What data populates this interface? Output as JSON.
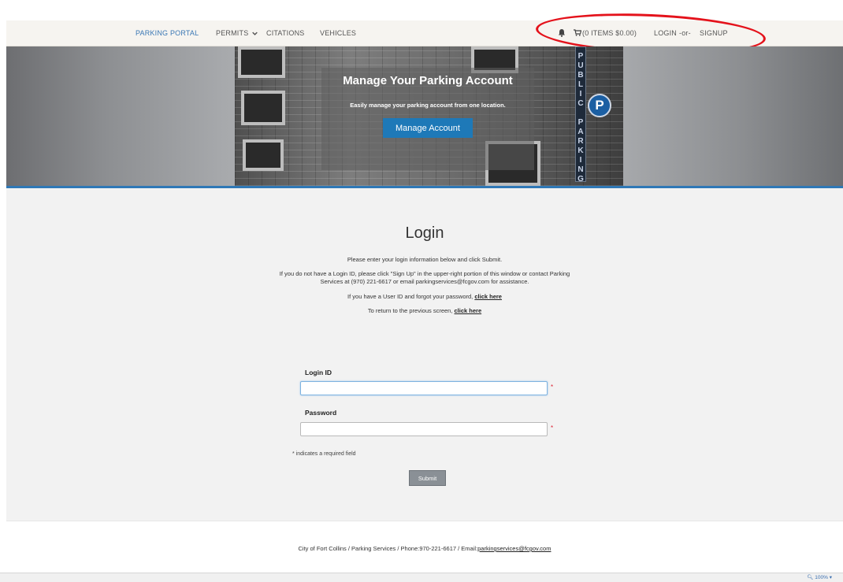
{
  "nav": {
    "portal": "PARKING PORTAL",
    "permits": "PERMITS",
    "citations": "CITATIONS",
    "vehicles": "VEHICLES",
    "cart": "(0 ITEMS $0.00)",
    "login": "LOGIN",
    "or": "-or-",
    "signup": "SIGNUP"
  },
  "hero": {
    "title": "Manage Your Parking Account",
    "subtitle": "Easily manage your parking account from one location.",
    "button": "Manage Account",
    "sign_letters": [
      "P",
      "U",
      "B",
      "L",
      "I",
      "C",
      "",
      "P",
      "A",
      "R",
      "K",
      "I",
      "N",
      "G"
    ],
    "p_badge": "P"
  },
  "login": {
    "title": "Login",
    "instructions": "Please enter your login information below and click Submit.",
    "no_id_line1": "If you do not have a Login ID, please click \"Sign Up\" in the upper-right portion of this window or contact Parking",
    "no_id_line2": "Services at (970) 221-6617 or email parkingservices@fcgov.com for assistance.",
    "forgot_text": "If you have a User ID and forgot your password,",
    "forgot_link": "click here",
    "return_text": "To return to the previous screen,",
    "return_link": "click here",
    "login_id_label": "Login ID",
    "password_label": "Password",
    "required_mark": "*",
    "required_note": "* indicates a required field",
    "submit": "Submit"
  },
  "footer": {
    "text": "City of Fort Collins / Parking Services / Phone:970-221-6617 / Email:",
    "email": "parkingservices@fcgov.com"
  },
  "status": {
    "zoom": "100%"
  },
  "colors": {
    "accent": "#2f78b6",
    "annotation": "#e4121b",
    "button_primary": "#1e79b8",
    "button_submit": "#8a9096"
  }
}
